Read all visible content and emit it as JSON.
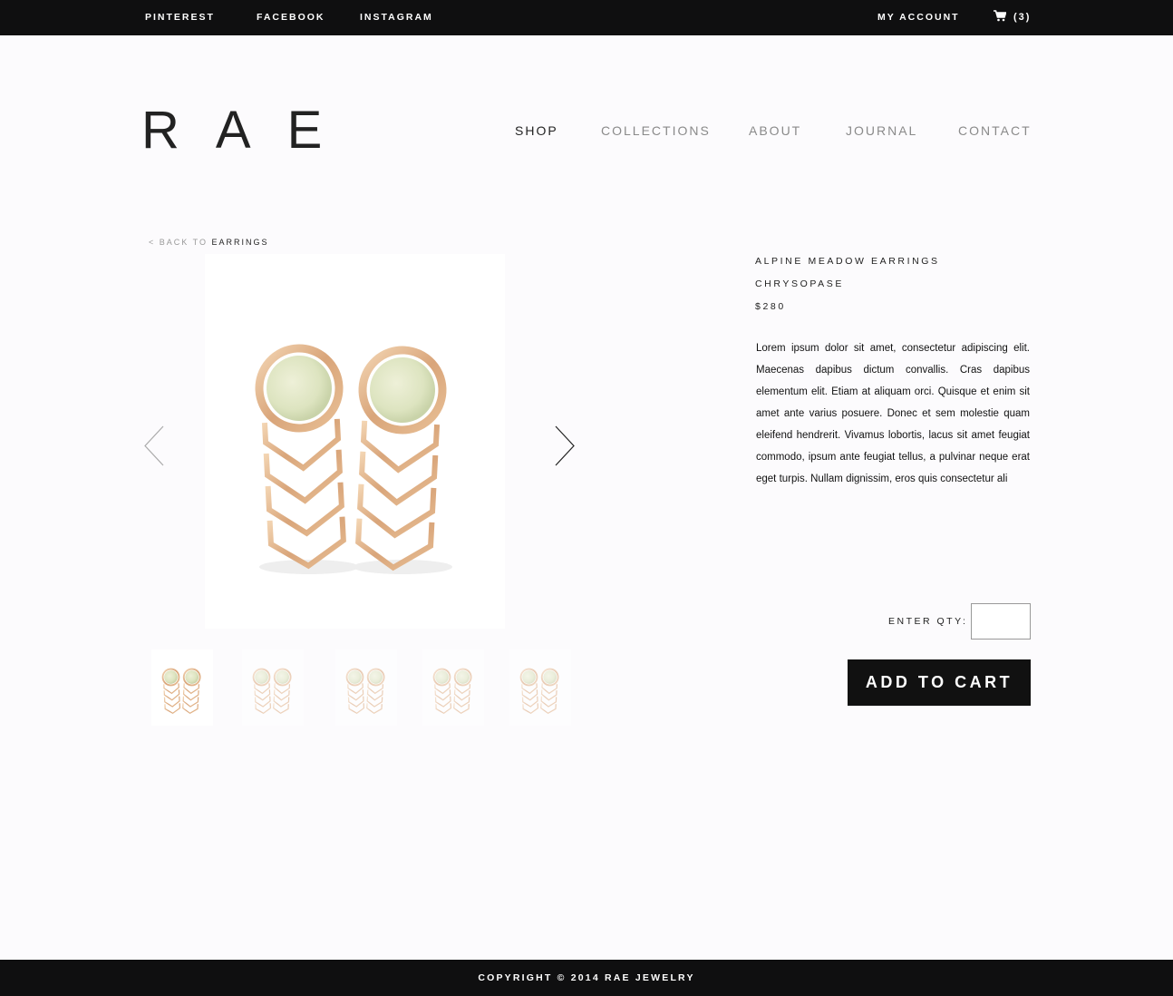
{
  "topbar": {
    "social": [
      "PINTEREST",
      "FACEBOOK",
      "INSTAGRAM"
    ],
    "account_label": "MY ACCOUNT",
    "cart_icon": "shopping-cart-icon",
    "cart_count": "(3)"
  },
  "brand": {
    "logo": "RAE"
  },
  "nav": {
    "items": [
      "SHOP",
      "COLLECTIONS",
      "ABOUT",
      "JOURNAL",
      "CONTACT"
    ],
    "active": "SHOP"
  },
  "breadcrumb": {
    "back": "< BACK TO",
    "category": "EARRINGS"
  },
  "gallery": {
    "prev_icon": "chevron-left-icon",
    "next_icon": "chevron-right-icon",
    "thumbnail_count": 5,
    "selected_thumbnail": 1
  },
  "product": {
    "name": "ALPINE MEADOW EARRINGS",
    "stone": "CHRYSOPASE",
    "price": "$280",
    "description": "Lorem ipsum dolor sit amet, consectetur adipiscing elit. Maecenas dapibus dictum convallis. Cras dapibus elementum elit. Etiam at aliquam orci. Quisque et enim sit amet ante varius posuere. Donec et sem molestie quam eleifend hendrerit. Vivamus lobortis, lacus sit amet feugiat commodo, ipsum ante feugiat tellus, a pulvinar neque erat eget turpis. Nullam dignissim, eros quis consectetur ali"
  },
  "purchase": {
    "qty_label": "ENTER QTY:",
    "qty_value": "",
    "add_to_cart": "ADD TO CART"
  },
  "footer": {
    "copyright": "COPYRIGHT © 2014 RAE JEWELRY"
  },
  "colors": {
    "bar_bg": "#0f0f10",
    "page_bg": "#fcfbfd",
    "gold": "#d9a87a",
    "stone": "#dfe6c6",
    "button_bg": "#111111"
  }
}
